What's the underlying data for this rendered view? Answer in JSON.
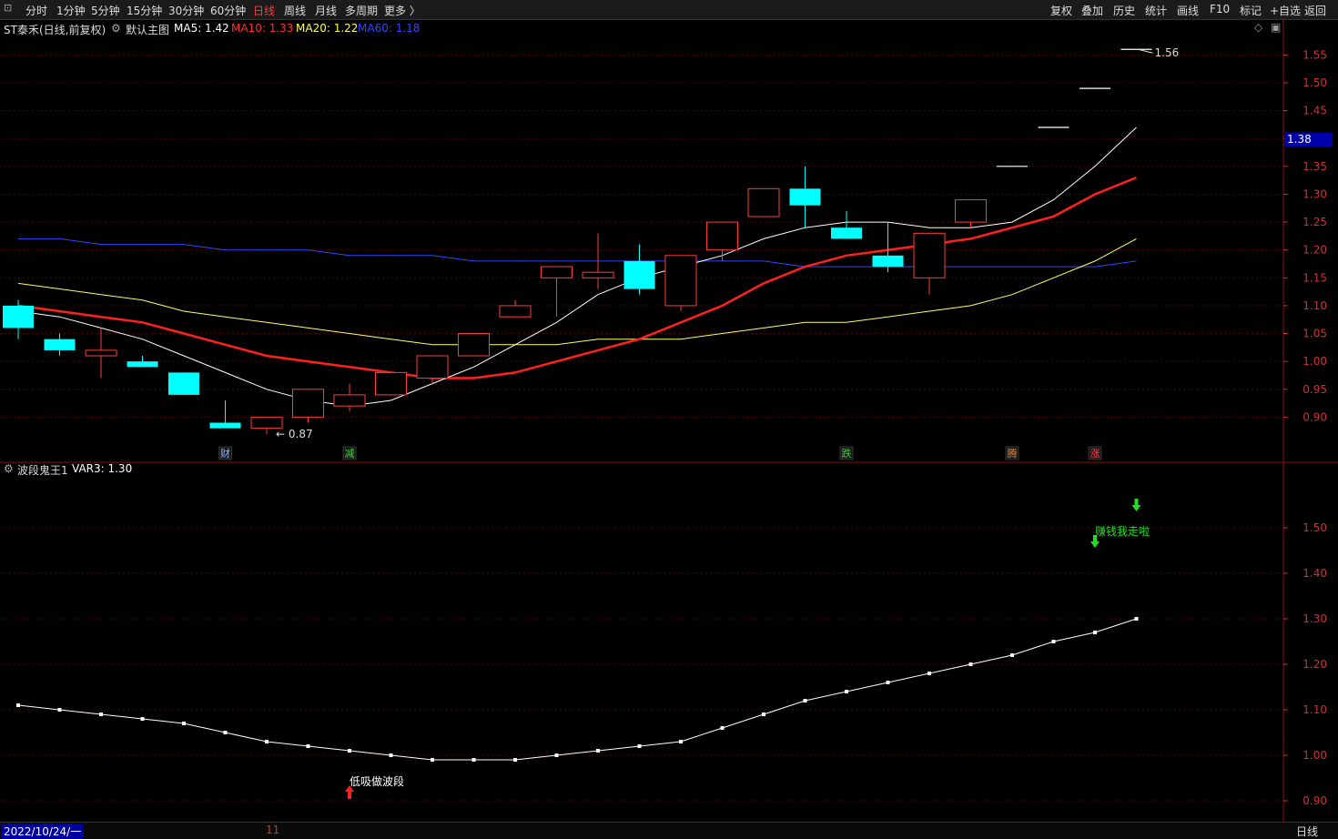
{
  "toolbar": {
    "left_icon": "box-icon",
    "periods": [
      "分时",
      "1分钟",
      "5分钟",
      "15分钟",
      "30分钟",
      "60分钟",
      "日线",
      "周线",
      "月线",
      "多周期",
      "更多 〉"
    ],
    "active_period": "日线",
    "right_buttons": [
      "复权",
      "叠加",
      "历史",
      "统计",
      "画线",
      "F10",
      "标记",
      "+自选",
      "返回"
    ]
  },
  "main_panel": {
    "stock_name": "ST泰禾(日线,前复权)",
    "template_label": "默认主图",
    "ma5": "MA5: 1.42",
    "ma10": "MA10: 1.33",
    "ma20": "MA20: 1.22",
    "ma60": "MA60: 1.18",
    "current_price_tag": "1.38",
    "high_label": "1.56",
    "low_label": "0.87",
    "y_ticks": [
      "1.55",
      "1.50",
      "1.45",
      "1.40",
      "1.35",
      "1.30",
      "1.25",
      "1.20",
      "1.15",
      "1.10",
      "1.05",
      "1.00",
      "0.95",
      "0.90"
    ],
    "event_tags": [
      {
        "text": "财",
        "color": "#8fb0ff"
      },
      {
        "text": "减",
        "color": "#3ecf3e"
      },
      {
        "text": "跌",
        "color": "#3ecf3e"
      },
      {
        "text": "腾",
        "color": "#e08a3c"
      },
      {
        "text": "涨",
        "color": "#ff4040"
      }
    ]
  },
  "sub_panel": {
    "indicator_name": "波段鬼王1",
    "var3": "VAR3: 1.30",
    "y_ticks": [
      "1.50",
      "1.40",
      "1.30",
      "1.20",
      "1.10",
      "1.00",
      "0.90"
    ],
    "buy_signal": "低吸做波段",
    "sell_signal": "赚钱我走啦"
  },
  "bottom": {
    "date": "2022/10/24/一",
    "month_marker": "11",
    "period_label": "日线"
  },
  "colors": {
    "up": "#ff3b3b",
    "down": "#00ffff",
    "ma5": "#ffffff",
    "ma10": "#ff2020",
    "ma20": "#ffff66",
    "ma60": "#3344ff",
    "grid": "#5a0000"
  },
  "chart_data": {
    "type": "candlestick",
    "candles": [
      {
        "o": 1.1,
        "h": 1.11,
        "l": 1.04,
        "c": 1.06
      },
      {
        "o": 1.04,
        "h": 1.05,
        "l": 1.01,
        "c": 1.02
      },
      {
        "o": 1.01,
        "h": 1.06,
        "l": 0.97,
        "c": 1.02
      },
      {
        "o": 1.0,
        "h": 1.01,
        "l": 0.99,
        "c": 0.99
      },
      {
        "o": 0.98,
        "h": 0.98,
        "l": 0.94,
        "c": 0.94
      },
      {
        "o": 0.89,
        "h": 0.93,
        "l": 0.89,
        "c": 0.88
      },
      {
        "o": 0.88,
        "h": 0.9,
        "l": 0.87,
        "c": 0.9
      },
      {
        "o": 0.9,
        "h": 0.95,
        "l": 0.89,
        "c": 0.95
      },
      {
        "o": 0.92,
        "h": 0.96,
        "l": 0.91,
        "c": 0.94
      },
      {
        "o": 0.94,
        "h": 0.98,
        "l": 0.94,
        "c": 0.98
      },
      {
        "o": 0.97,
        "h": 1.01,
        "l": 0.96,
        "c": 1.01
      },
      {
        "o": 1.01,
        "h": 1.05,
        "l": 1.01,
        "c": 1.05
      },
      {
        "o": 1.08,
        "h": 1.11,
        "l": 1.08,
        "c": 1.1
      },
      {
        "o": 1.15,
        "h": 1.17,
        "l": 1.08,
        "c": 1.17
      },
      {
        "o": 1.15,
        "h": 1.23,
        "l": 1.13,
        "c": 1.16
      },
      {
        "o": 1.18,
        "h": 1.21,
        "l": 1.12,
        "c": 1.13
      },
      {
        "o": 1.1,
        "h": 1.19,
        "l": 1.09,
        "c": 1.19
      },
      {
        "o": 1.2,
        "h": 1.25,
        "l": 1.18,
        "c": 1.25
      },
      {
        "o": 1.26,
        "h": 1.31,
        "l": 1.26,
        "c": 1.31
      },
      {
        "o": 1.31,
        "h": 1.35,
        "l": 1.24,
        "c": 1.28
      },
      {
        "o": 1.24,
        "h": 1.27,
        "l": 1.22,
        "c": 1.22
      },
      {
        "o": 1.19,
        "h": 1.25,
        "l": 1.16,
        "c": 1.17
      },
      {
        "o": 1.15,
        "h": 1.23,
        "l": 1.12,
        "c": 1.23
      },
      {
        "o": 1.25,
        "h": 1.29,
        "l": 1.24,
        "c": 1.29
      },
      {
        "o": 1.35,
        "h": 1.35,
        "l": 1.35,
        "c": 1.35
      },
      {
        "o": 1.42,
        "h": 1.42,
        "l": 1.42,
        "c": 1.42
      },
      {
        "o": 1.49,
        "h": 1.49,
        "l": 1.49,
        "c": 1.49
      },
      {
        "o": 1.56,
        "h": 1.56,
        "l": 1.56,
        "c": 1.56
      }
    ],
    "ma5": [
      1.09,
      1.08,
      1.06,
      1.04,
      1.01,
      0.98,
      0.95,
      0.93,
      0.92,
      0.93,
      0.96,
      0.99,
      1.03,
      1.07,
      1.12,
      1.15,
      1.17,
      1.19,
      1.22,
      1.24,
      1.25,
      1.25,
      1.24,
      1.24,
      1.25,
      1.29,
      1.35,
      1.42
    ],
    "ma10": [
      1.1,
      1.09,
      1.08,
      1.07,
      1.05,
      1.03,
      1.01,
      1.0,
      0.99,
      0.98,
      0.97,
      0.97,
      0.98,
      1.0,
      1.02,
      1.04,
      1.07,
      1.1,
      1.14,
      1.17,
      1.19,
      1.2,
      1.21,
      1.22,
      1.24,
      1.26,
      1.3,
      1.33
    ],
    "ma20": [
      1.14,
      1.13,
      1.12,
      1.11,
      1.09,
      1.08,
      1.07,
      1.06,
      1.05,
      1.04,
      1.03,
      1.03,
      1.03,
      1.03,
      1.04,
      1.04,
      1.04,
      1.05,
      1.06,
      1.07,
      1.07,
      1.08,
      1.09,
      1.1,
      1.12,
      1.15,
      1.18,
      1.22
    ],
    "ma60": [
      1.22,
      1.22,
      1.21,
      1.21,
      1.21,
      1.2,
      1.2,
      1.2,
      1.19,
      1.19,
      1.19,
      1.18,
      1.18,
      1.18,
      1.18,
      1.18,
      1.18,
      1.18,
      1.18,
      1.17,
      1.17,
      1.17,
      1.17,
      1.17,
      1.17,
      1.17,
      1.17,
      1.18
    ],
    "var3": [
      1.11,
      1.1,
      1.09,
      1.08,
      1.07,
      1.05,
      1.03,
      1.02,
      1.01,
      1.0,
      0.99,
      0.99,
      0.99,
      1.0,
      1.01,
      1.02,
      1.03,
      1.06,
      1.09,
      1.12,
      1.14,
      1.16,
      1.18,
      1.2,
      1.22,
      1.25,
      1.27,
      1.3
    ],
    "main_ylim": [
      0.85,
      1.58
    ],
    "sub_ylim": [
      0.88,
      1.6
    ]
  }
}
